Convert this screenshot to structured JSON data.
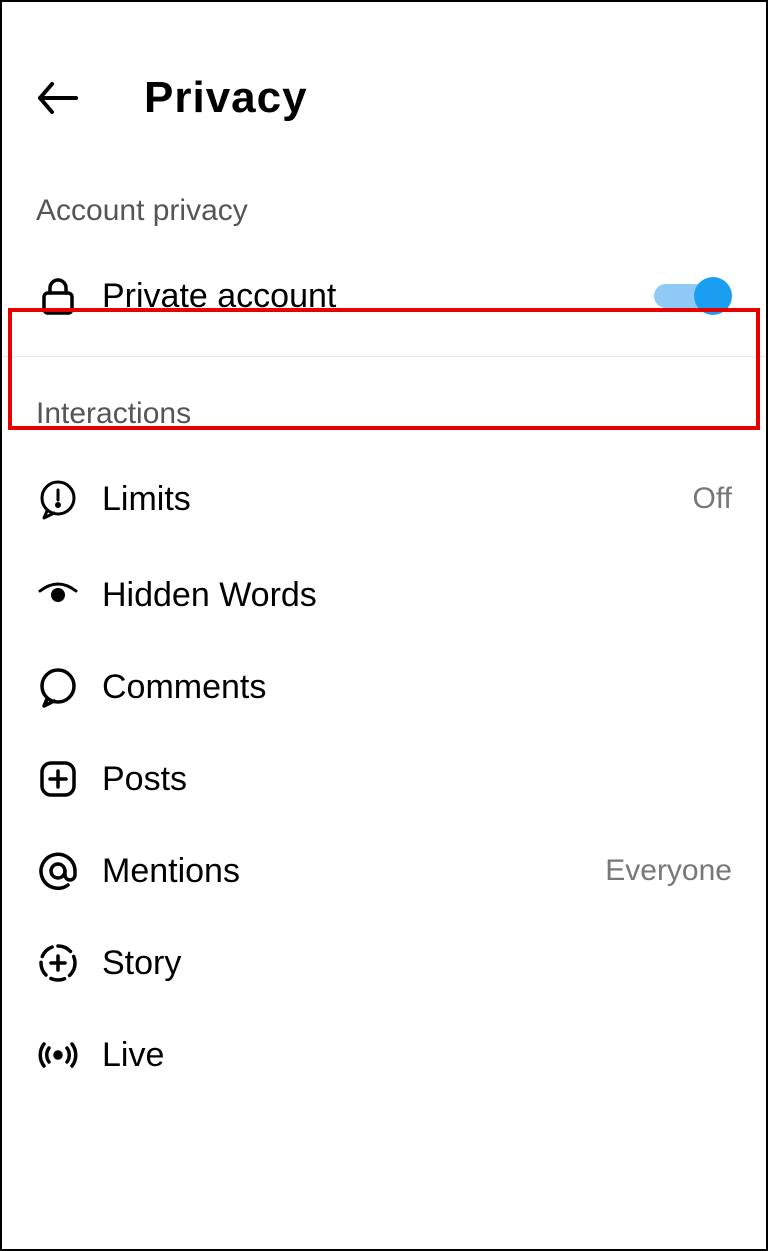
{
  "header": {
    "title": "Privacy"
  },
  "sections": {
    "account_privacy": {
      "label": "Account privacy",
      "private_account": {
        "label": "Private account",
        "on": true
      }
    },
    "interactions": {
      "label": "Interactions",
      "limits": {
        "label": "Limits",
        "value": "Off"
      },
      "hidden_words": {
        "label": "Hidden Words"
      },
      "comments": {
        "label": "Comments"
      },
      "posts": {
        "label": "Posts"
      },
      "mentions": {
        "label": "Mentions",
        "value": "Everyone"
      },
      "story": {
        "label": "Story"
      },
      "live": {
        "label": "Live"
      }
    }
  }
}
